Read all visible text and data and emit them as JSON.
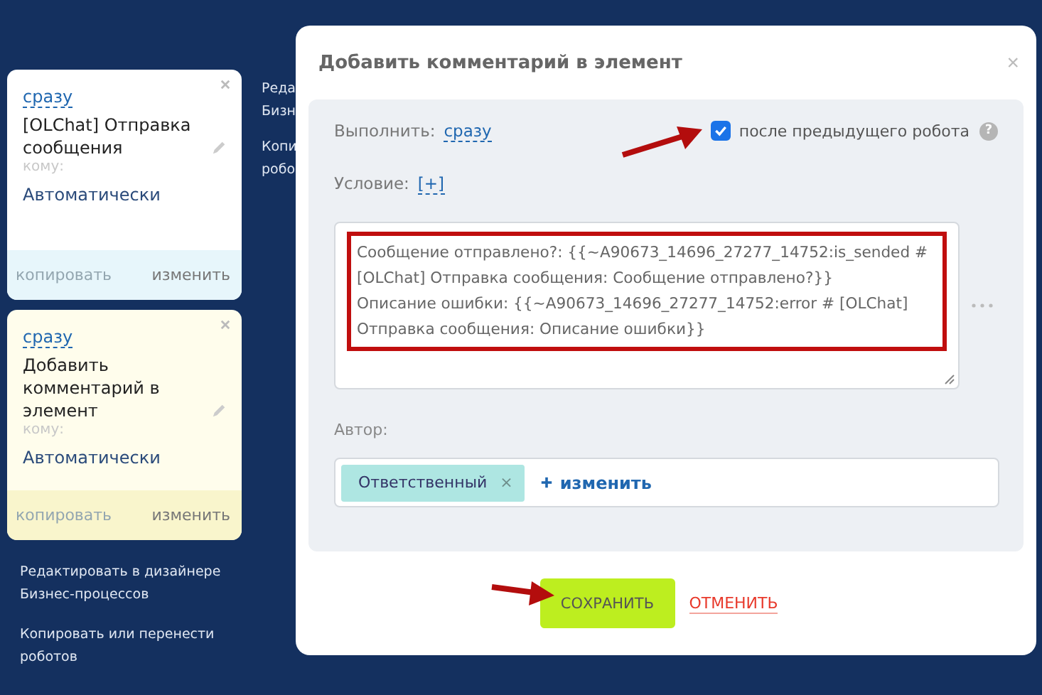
{
  "cards": [
    {
      "delay": "сразу",
      "title": "[OLChat] Отправка сообщения",
      "recipient_label": "кому:",
      "recipient": "Автоматически",
      "copy": "копировать",
      "edit": "изменить",
      "selected": false
    },
    {
      "delay": "сразу",
      "title": "Добавить комментарий в элемент",
      "recipient_label": "кому:",
      "recipient": "Автоматически",
      "copy": "копировать",
      "edit": "изменить",
      "selected": true
    }
  ],
  "side_links": [
    "Редактировать в дизайнере Бизнес-процессов",
    "Копировать или перенести роботов"
  ],
  "hidden_links": [
    [
      "Реда",
      "Бизн"
    ],
    [
      "Копи",
      "робо"
    ]
  ],
  "dialog": {
    "title": "Добавить комментарий в элемент",
    "close": "×",
    "run_label": "Выполнить:",
    "run_value": "сразу",
    "after_previous": {
      "label": "после предыдущего робота",
      "checked": true,
      "help": "?"
    },
    "condition_label": "Условие:",
    "condition_value": "[+]",
    "comment_lines": [
      "Сообщение отправлено?: {{~A90673_14696_27277_14752:is_sended # [OLChat] Отправка сообщения: Сообщение отправлено?}}",
      "Описание ошибки: {{~A90673_14696_27277_14752:error # [OLChat] Отправка сообщения: Описание ошибки}}"
    ],
    "author_label": "Автор:",
    "author_tags": [
      {
        "label": "Ответственный",
        "remove": "×"
      }
    ],
    "author_change": "изменить",
    "save": "СОХРАНИТЬ",
    "cancel": "ОТМЕНИТЬ"
  }
}
